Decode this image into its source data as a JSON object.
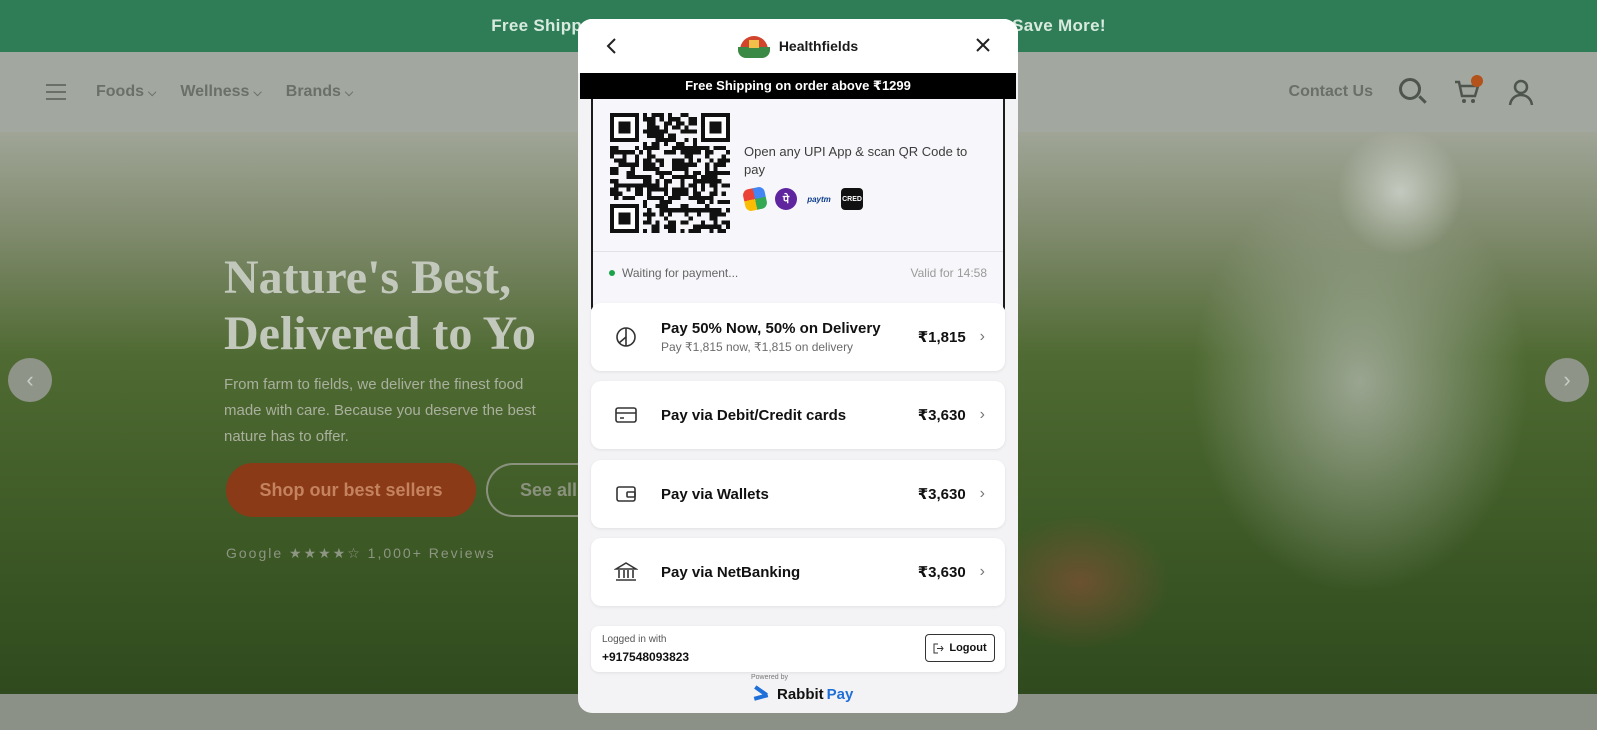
{
  "background": {
    "announcement_left": "Free Shipp",
    "announcement_right": "Save More!",
    "nav": [
      "Foods",
      "Wellness",
      "Brands"
    ],
    "contact": "Contact Us",
    "hero_title_1": "Nature's Best,",
    "hero_title_2": "Delivered to Yo",
    "hero_desc": "From farm to fields, we deliver the finest food made with care. Because you deserve the best nature has to offer.",
    "shop_button": "Shop our best sellers",
    "all_button": "See all",
    "rating": "Google ★★★★☆   1,000+ Reviews"
  },
  "modal": {
    "brand": "Healthfields",
    "shipping_banner": "Free Shipping on order above ₹1299",
    "qr": {
      "instruction": "Open any UPI App & scan QR Code to pay",
      "apps": [
        "gpay-icon",
        "phonepe-icon",
        "paytm-icon",
        "cred-icon"
      ],
      "paytm_label": "paytm",
      "cred_label": "CRED",
      "phonepe_label": "पे",
      "waiting": "Waiting for payment...",
      "valid": "Valid for 14:58"
    },
    "options": [
      {
        "title": "Pay 50% Now, 50% on Delivery",
        "subtitle": "Pay ₹1,815 now, ₹1,815 on delivery",
        "price": "₹1,815"
      },
      {
        "title": "Pay via Debit/Credit cards",
        "subtitle": "",
        "price": "₹3,630"
      },
      {
        "title": "Pay via Wallets",
        "subtitle": "",
        "price": "₹3,630"
      },
      {
        "title": "Pay via NetBanking",
        "subtitle": "",
        "price": "₹3,630"
      }
    ],
    "login": {
      "label": "Logged in with",
      "phone": "+917548093823",
      "logout": "Logout"
    },
    "powered_by": "Powered by",
    "rabbit_1": "Rabbit",
    "rabbit_2": "Pay"
  }
}
